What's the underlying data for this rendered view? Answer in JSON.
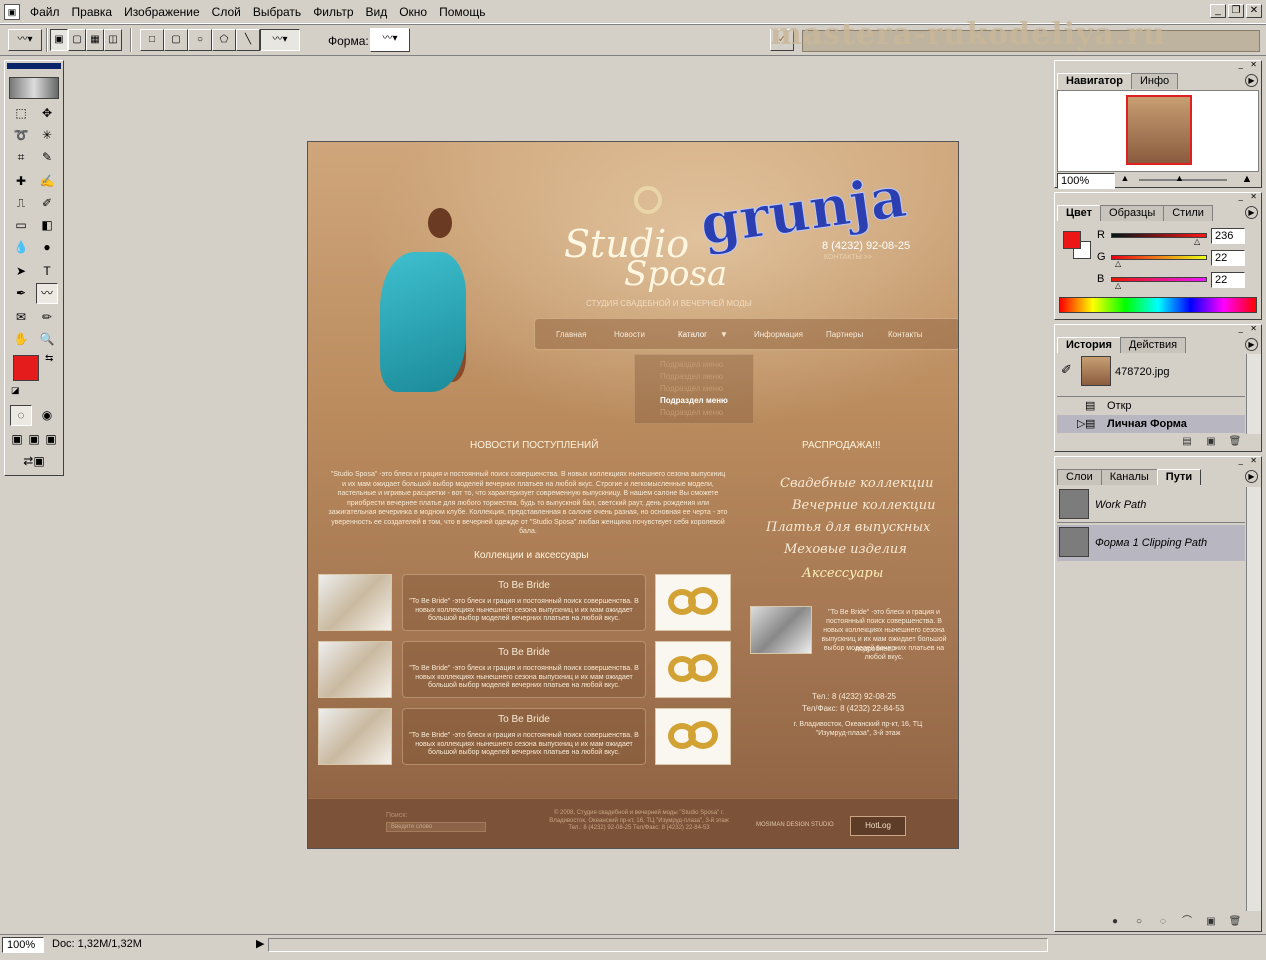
{
  "menu": [
    "Файл",
    "Правка",
    "Изображение",
    "Слой",
    "Выбрать",
    "Фильтр",
    "Вид",
    "Окно",
    "Помощь"
  ],
  "options": {
    "shape_label": "Форма:"
  },
  "watermark": "mastera-rukodeliya.ru",
  "toolbox_colors": {
    "foreground": "#e51c1c",
    "background": "#ffffff"
  },
  "site": {
    "phone": "8 (4232) 92-08-25",
    "contacts_link": "КОНТАКТЫ >>",
    "logo_top": "Studio",
    "logo_bottom": "Sposa",
    "overlay_text": "grunja",
    "tagline": "СТУДИЯ СВАДЕБНОЙ И ВЕЧЕРНЕЙ МОДЫ",
    "nav": [
      "Главная",
      "Новости",
      "Каталог",
      "Информация",
      "Партнеры",
      "Контакты"
    ],
    "submenu": [
      "Подраздел меню",
      "Подраздел меню",
      "Подраздел меню",
      "Подраздел меню",
      "Подраздел меню"
    ],
    "news_title": "НОВОСТИ ПОСТУПЛЕНИЙ",
    "news_text": "\"Studio Sposa\" -это блеск и грация и постоянный поиск совершенства. В новых коллекциях нынешнего сезона выпускниц и их мам ожидает большой выбор моделей вечерних платьев на любой вкус. Строгие и легкомысленные модели, пастельные и игривые расцветки - вот то, что характеризует современную выпускницу. В нашем салоне Вы сможете приобрести вечернее платье для любого торжества, будь то выпускной бал, светский раут, день рождения или зажигательная вечеринка в модном клубе. Коллекция, представленная в салоне очень разная, но основная ее черта - это уверенность ее создателей в том, что в вечерней одежде от \"Studio Sposa\" любая женщина почувствует себя королевой бала.",
    "sale_title": "РАСПРОДАЖА!!!",
    "sale_links": [
      "Свадебные коллекции",
      "Вечерние коллекции",
      "Платья для выпускных",
      "Меховые изделия",
      "Аксессуары"
    ],
    "collections_title": "Коллекции и аксессуары",
    "cards": [
      {
        "title": "To Be Bride",
        "text": "\"To Be Bride\" -это блеск и грация и постоянный поиск совершенства. В новых коллекциях нынешнего сезона выпускниц и их мам ожидает большой выбор моделей вечерних платьев на любой вкус."
      },
      {
        "title": "To Be Bride",
        "text": "\"To Be Bride\" -это блеск и грация и постоянный поиск совершенства. В новых коллекциях нынешнего сезона выпускниц и их мам ожидает большой выбор моделей вечерних платьев на любой вкус."
      },
      {
        "title": "To Be Bride",
        "text": "\"To Be Bride\" -это блеск и грация и постоянный поиск совершенства. В новых коллекциях нынешнего сезона выпускниц и их мам ожидает большой выбор моделей вечерних платьев на любой вкус."
      }
    ],
    "promo_text": "\"To Be Bride\" -это блеск и грация и постоянный поиск совершенства. В новых коллекциях нынешнего сезона выпускниц и их мам ожидает большой выбор моделей вечерних платьев на любой вкус.",
    "promo_more": "подробнее >",
    "tel": "Тел.: 8 (4232) 92-08-25",
    "fax": "Тел/Факс: 8 (4232) 22-84-53",
    "address": "г. Владивосток, Океанский пр-кт, 16, ТЦ \"Изумруд-плаза\", 3-й этаж",
    "footer_search_label": "Поиск:",
    "footer_search_placeholder": "Введите слово",
    "footer_copy": "© 2008, Студия свадебной и вечерней моды \"Studio Sposa\" г. Владивосток, Океанский пр-кт, 16, ТЦ \"Изумруд-плаза\", 3-й этаж Тел.: 8 (4232) 92-08-25 Тел/Факс: 8 (4232) 22-84-53",
    "footer_studio": "MOSIMAN DESIGN STUDIO",
    "footer_badge": "HotLog"
  },
  "navigator": {
    "tabs": [
      "Навигатор",
      "Инфо"
    ],
    "zoom": "100%"
  },
  "color": {
    "tabs": [
      "Цвет",
      "Образцы",
      "Стили"
    ],
    "r_label": "R",
    "g_label": "G",
    "b_label": "B",
    "r": "236",
    "g": "22",
    "b": "22",
    "fg": "#ec1616"
  },
  "history": {
    "tabs": [
      "История",
      "Действия"
    ],
    "snapshot": "478720.jpg",
    "items": [
      "Откр",
      "Личная Форма"
    ]
  },
  "paths": {
    "tabs": [
      "Слои",
      "Каналы",
      "Пути"
    ],
    "items": [
      "Work Path",
      "Форма 1 Clipping Path"
    ]
  },
  "status": {
    "zoom": "100%",
    "doc": "Doc: 1,32M/1,32M"
  }
}
